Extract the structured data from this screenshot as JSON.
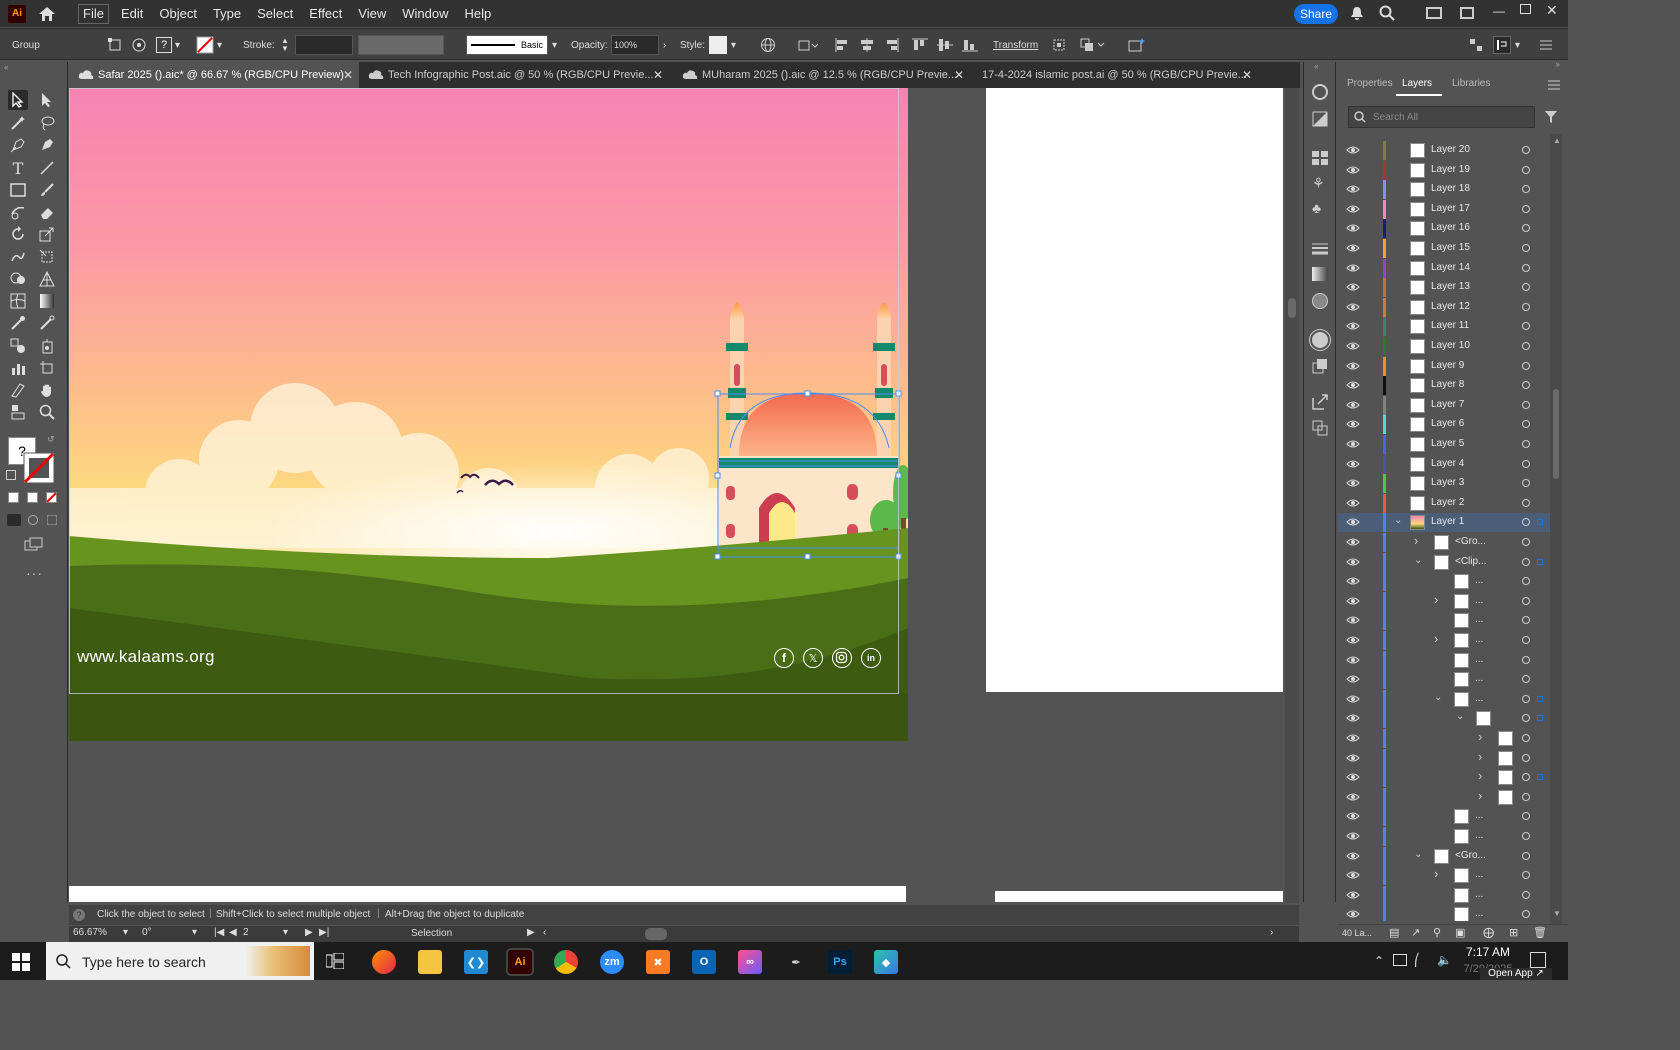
{
  "app": {
    "logo": "Ai"
  },
  "menu": [
    "File",
    "Edit",
    "Object",
    "Type",
    "Select",
    "Effect",
    "View",
    "Window",
    "Help"
  ],
  "share_label": "Share",
  "control": {
    "selection_type": "Group",
    "stroke_label": "Stroke:",
    "brush_label": "Basic",
    "opacity_label": "Opacity:",
    "opacity_value": "100%",
    "style_label": "Style:",
    "transform_label": "Transform"
  },
  "tabs": [
    {
      "label": "Safar 2025 ().aic* @ 66.67 % (RGB/CPU Preview)",
      "active": true
    },
    {
      "label": "Tech Infographic Post.aic @ 50 % (RGB/CPU Previe...",
      "active": false
    },
    {
      "label": "MUharam 2025 ().aic @ 12.5 % (RGB/CPU Previe...",
      "active": false
    },
    {
      "label": "17-4-2024 islamic post.ai @ 50 % (RGB/CPU Previe...",
      "active": false
    }
  ],
  "artwork": {
    "website": "www.kalaams.org",
    "social_icons": [
      "facebook-icon",
      "x-icon",
      "instagram-icon",
      "linkedin-icon"
    ]
  },
  "panel": {
    "tabs": [
      "Properties",
      "Layers",
      "Libraries"
    ],
    "active_tab": "Layers",
    "search_placeholder": "Search All",
    "layers_count": "40 La..."
  },
  "layers": [
    {
      "name": "Layer 20",
      "color": "#7f7f3a",
      "indent": 0
    },
    {
      "name": "Layer 19",
      "color": "#b03030",
      "indent": 0
    },
    {
      "name": "Layer 18",
      "color": "#7f8fff",
      "indent": 0
    },
    {
      "name": "Layer 17",
      "color": "#ff7fbf",
      "indent": 0
    },
    {
      "name": "Layer 16",
      "color": "#1a1a80",
      "indent": 0
    },
    {
      "name": "Layer 15",
      "color": "#ff9f1a",
      "indent": 0
    },
    {
      "name": "Layer 14",
      "color": "#9a3fd0",
      "indent": 0
    },
    {
      "name": "Layer 13",
      "color": "#d06a2a",
      "indent": 0
    },
    {
      "name": "Layer 12",
      "color": "#d9772a",
      "indent": 0
    },
    {
      "name": "Layer 11",
      "color": "#2a8a6a",
      "indent": 0
    },
    {
      "name": "Layer 10",
      "color": "#2a7a2a",
      "indent": 0
    },
    {
      "name": "Layer 9",
      "color": "#ff8a1a",
      "indent": 0
    },
    {
      "name": "Layer 8",
      "color": "#111111",
      "indent": 0
    },
    {
      "name": "Layer 7",
      "color": "#808080",
      "indent": 0
    },
    {
      "name": "Layer 6",
      "color": "#40e0e0",
      "indent": 0
    },
    {
      "name": "Layer 5",
      "color": "#4f5fff",
      "indent": 0
    },
    {
      "name": "Layer 4",
      "color": "#4f4fb0",
      "indent": 0
    },
    {
      "name": "Layer 3",
      "color": "#3fd03f",
      "indent": 0
    },
    {
      "name": "Layer 2",
      "color": "#ff4f4f",
      "indent": 0
    },
    {
      "name": "Layer 1",
      "color": "#4f7fff",
      "indent": 0,
      "expanded": true,
      "selected": true
    },
    {
      "name": "<Gro...",
      "color": "#4f7fff",
      "indent": 1,
      "chevron": "right"
    },
    {
      "name": "<Clip...",
      "color": "#4f7fff",
      "indent": 1,
      "chevron": "down"
    },
    {
      "name": "...",
      "color": "#4f7fff",
      "indent": 2
    },
    {
      "name": "...",
      "color": "#4f7fff",
      "indent": 2,
      "chevron": "right"
    },
    {
      "name": "...",
      "color": "#4f7fff",
      "indent": 2
    },
    {
      "name": "...",
      "color": "#4f7fff",
      "indent": 2,
      "chevron": "right"
    },
    {
      "name": "...",
      "color": "#4f7fff",
      "indent": 2
    },
    {
      "name": "...",
      "color": "#4f7fff",
      "indent": 2
    },
    {
      "name": "...",
      "color": "#4f7fff",
      "indent": 2,
      "chevron": "down"
    },
    {
      "name": "",
      "color": "#4f7fff",
      "indent": 3,
      "chevron": "down"
    },
    {
      "name": "",
      "color": "#4f7fff",
      "indent": 4,
      "chevron": "right"
    },
    {
      "name": "",
      "color": "#4f7fff",
      "indent": 4,
      "chevron": "right"
    },
    {
      "name": "",
      "color": "#4f7fff",
      "indent": 4,
      "chevron": "right"
    },
    {
      "name": "",
      "color": "#4f7fff",
      "indent": 4,
      "chevron": "right"
    },
    {
      "name": "...",
      "color": "#4f7fff",
      "indent": 2
    },
    {
      "name": "...",
      "color": "#4f7fff",
      "indent": 2
    },
    {
      "name": "<Gro...",
      "color": "#4f7fff",
      "indent": 1,
      "chevron": "down"
    },
    {
      "name": "...",
      "color": "#4f7fff",
      "indent": 2,
      "chevron": "right"
    },
    {
      "name": "...",
      "color": "#4f7fff",
      "indent": 2
    },
    {
      "name": "...",
      "color": "#4f7fff",
      "indent": 2
    }
  ],
  "hint": {
    "text1": "Click the object to select",
    "text2": "Shift+Click to select multiple object",
    "text3": "Alt+Drag the object to duplicate"
  },
  "status": {
    "zoom": "66.67%",
    "rotation": "0°",
    "artboard": "2",
    "tool": "Selection"
  },
  "taskbar": {
    "search_placeholder": "Type here to search",
    "time": "7:17 AM",
    "date": "7/29/2025",
    "open_app": "Open App"
  },
  "colors": {
    "accent": "#1473e6",
    "sky_top": "#f783b3",
    "sky_mid": "#fdbb8c",
    "grass": "#3f5d14",
    "dome": "#f7845a"
  }
}
